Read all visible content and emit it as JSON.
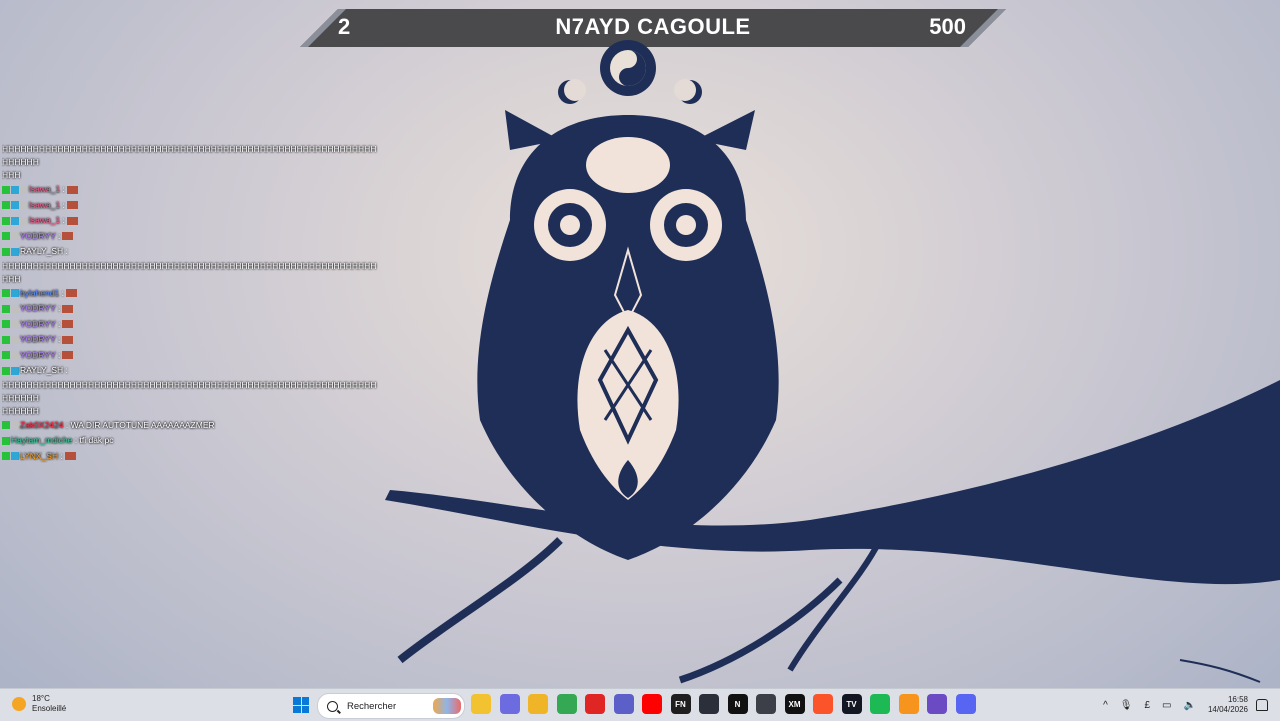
{
  "banner": {
    "left_value": "2",
    "title": "N7AYD CAGOULE",
    "right_value": "500"
  },
  "chat": [
    {
      "text": "HHHHHHHHHHHHHHHHHHHHHHHHHHHHHHHHHHHHHHHHHHHHHHHHHHHHHHHHHHHHHHHHHHH",
      "kind": "text"
    },
    {
      "text": "HHH",
      "kind": "text"
    },
    {
      "user": "lsawa_1",
      "color": "pink",
      "suffix": " :",
      "badges": [
        "mod",
        "sub",
        "vip"
      ],
      "emote": true
    },
    {
      "user": "lsawa_1",
      "color": "pink",
      "suffix": " :",
      "badges": [
        "mod",
        "sub",
        "vip"
      ],
      "emote": true
    },
    {
      "user": "lsawa_1",
      "color": "pink",
      "suffix": " :",
      "badges": [
        "mod",
        "sub",
        "vip"
      ],
      "emote": true
    },
    {
      "user": "YODRYY",
      "color": "purple",
      "suffix": " :",
      "badges": [
        "mod",
        "vip"
      ],
      "emote": true
    },
    {
      "user": "RAYLY_SH",
      "color": "white",
      "suffix": " :",
      "badges": [
        "mod",
        "sub"
      ],
      "emote": false
    },
    {
      "text": "HHHHHHHHHHHHHHHHHHHHHHHHHHHHHHHHHHHHHHHHHHHHHHHHHHHHHHHHHHHHHHHH",
      "kind": "text"
    },
    {
      "user": "bylahend1",
      "color": "blue",
      "suffix": " :",
      "badges": [
        "mod",
        "sub"
      ],
      "emote": true
    },
    {
      "user": "YODRYY",
      "color": "purple",
      "suffix": " :",
      "badges": [
        "mod",
        "vip"
      ],
      "emote": true
    },
    {
      "user": "YODRYY",
      "color": "purple",
      "suffix": " :",
      "badges": [
        "mod",
        "vip"
      ],
      "emote": true
    },
    {
      "user": "YODRYY",
      "color": "purple",
      "suffix": " :",
      "badges": [
        "mod",
        "vip"
      ],
      "emote": true
    },
    {
      "user": "YODRYY",
      "color": "purple",
      "suffix": " :",
      "badges": [
        "mod",
        "vip"
      ],
      "emote": true
    },
    {
      "user": "RAYLY_SH",
      "color": "white",
      "suffix": " :",
      "badges": [
        "mod",
        "sub"
      ],
      "emote": false
    },
    {
      "text": "HHHHHHHHHHHHHHHHHHHHHHHHHHHHHHHHHHHHHHHHHHHHHHHHHHHHHHHHHHHHHHHHHHH",
      "kind": "text"
    },
    {
      "text": "HHHHHH",
      "kind": "text"
    },
    {
      "user": "Zak0X2424",
      "color": "red",
      "suffix": " : WA DIR AUTOTUNE AAAAAAAZMER",
      "badges": [
        "mod",
        "vip"
      ],
      "emote": false
    },
    {
      "user": "Haytam_mdiche",
      "color": "green",
      "suffix": " : tfi dak pc",
      "badges": [
        "mod"
      ],
      "emote": false
    },
    {
      "user": "LYNX_SH",
      "color": "orange",
      "suffix": " :",
      "badges": [
        "mod",
        "sub"
      ],
      "emote": true
    }
  ],
  "taskbar": {
    "weather_temp": "18°C",
    "weather_desc": "Ensoleillé",
    "search_label": "Rechercher",
    "apps": [
      {
        "icon": "file-explorer-icon",
        "color": "#f2c230",
        "label": ""
      },
      {
        "icon": "copilot-icon",
        "color": "#6d6be0",
        "label": ""
      },
      {
        "icon": "folder-icon",
        "color": "#f0b429",
        "label": ""
      },
      {
        "icon": "chrome-icon",
        "color": "#34a853",
        "label": ""
      },
      {
        "icon": "acrobat-icon",
        "color": "#e02525",
        "label": ""
      },
      {
        "icon": "teams-icon",
        "color": "#5b5fc7",
        "label": ""
      },
      {
        "icon": "youtube-icon",
        "color": "#ff0000",
        "label": ""
      },
      {
        "icon": "fortnite-icon",
        "color": "#1f1f1f",
        "label": "FN"
      },
      {
        "icon": "steam-icon",
        "color": "#2a2f3a",
        "label": ""
      },
      {
        "icon": "netflix-icon",
        "color": "#111111",
        "label": "N"
      },
      {
        "icon": "gamepad-icon",
        "color": "#3c3f48",
        "label": ""
      },
      {
        "icon": "xm-icon",
        "color": "#111111",
        "label": "XM"
      },
      {
        "icon": "brave-icon",
        "color": "#fb542b",
        "label": ""
      },
      {
        "icon": "tradingview-icon",
        "color": "#131722",
        "label": "TV"
      },
      {
        "icon": "spotify-like-icon",
        "color": "#1db954",
        "label": ""
      },
      {
        "icon": "fl-studio-icon",
        "color": "#f7941d",
        "label": ""
      },
      {
        "icon": "obs-icon",
        "color": "#6a4bc4",
        "label": ""
      },
      {
        "icon": "discord-icon",
        "color": "#5865f2",
        "label": ""
      }
    ],
    "keyboard_lang": "£",
    "time": "16:58",
    "date": "14/04/2026"
  }
}
